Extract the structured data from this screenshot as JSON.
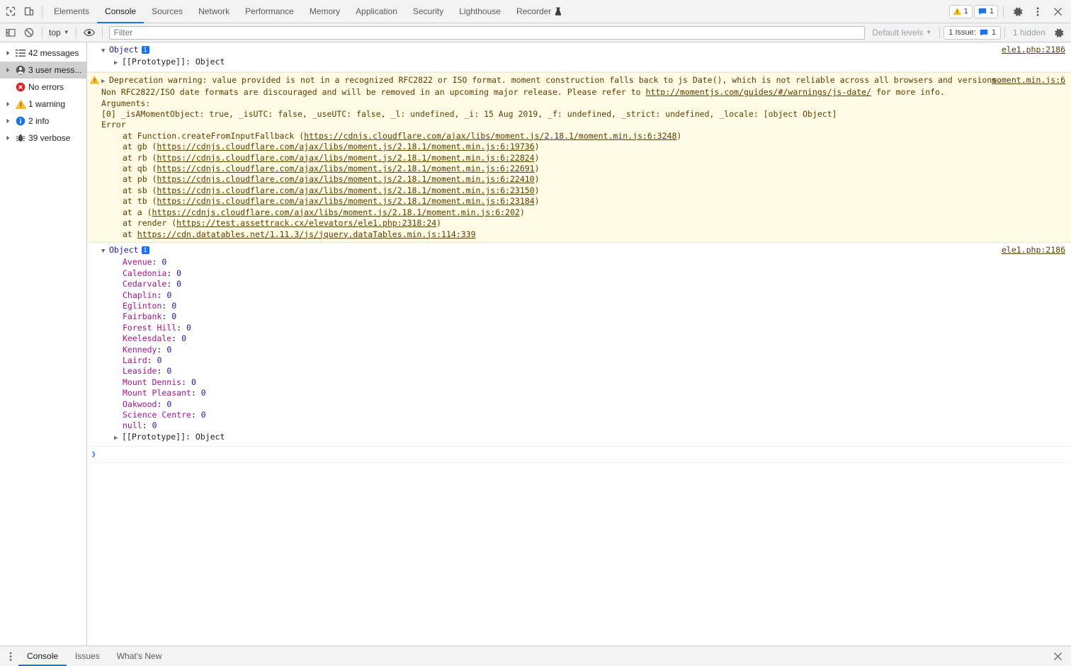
{
  "tabbar": {
    "left_icons": [
      {
        "name": "inspect-element-icon",
        "title": "Inspect"
      },
      {
        "name": "device-toolbar-icon",
        "title": "Toggle device toolbar"
      }
    ],
    "tabs": [
      {
        "label": "Elements",
        "active": false,
        "icon": null
      },
      {
        "label": "Console",
        "active": true,
        "icon": null
      },
      {
        "label": "Sources",
        "active": false,
        "icon": null
      },
      {
        "label": "Network",
        "active": false,
        "icon": null
      },
      {
        "label": "Performance",
        "active": false,
        "icon": null
      },
      {
        "label": "Memory",
        "active": false,
        "icon": null
      },
      {
        "label": "Application",
        "active": false,
        "icon": null
      },
      {
        "label": "Security",
        "active": false,
        "icon": null
      },
      {
        "label": "Lighthouse",
        "active": false,
        "icon": null
      },
      {
        "label": "Recorder",
        "active": false,
        "icon": "flask-icon"
      }
    ],
    "warning_badge_count": "1",
    "message_badge_count": "1"
  },
  "filterbar": {
    "sidebar_toggle": "console-sidebar-toggle-icon",
    "clear_label": "clear-console-icon",
    "context": "top",
    "eye_icon": "live-expression-icon",
    "filter_placeholder": "Filter",
    "filter_value": "",
    "levels_label": "Default levels",
    "issue_label": "1 Issue:",
    "issue_count": "1",
    "hidden_label": "1 hidden",
    "settings_icon": "gear-icon"
  },
  "sidebar": {
    "items": [
      {
        "label": "42 messages",
        "icon": "list-icon",
        "arrow": true,
        "selected": false
      },
      {
        "label": "3 user mess...",
        "icon": "user-icon",
        "arrow": true,
        "selected": true
      },
      {
        "label": "No errors",
        "icon": "error-icon",
        "arrow": false,
        "selected": false
      },
      {
        "label": "1 warning",
        "icon": "warning-icon",
        "arrow": true,
        "selected": false
      },
      {
        "label": "2 info",
        "icon": "info-icon",
        "arrow": true,
        "selected": false
      },
      {
        "label": "39 verbose",
        "icon": "verbose-bug-icon",
        "arrow": true,
        "selected": false
      }
    ]
  },
  "console": {
    "messages": [
      {
        "id": "msg-object-1",
        "type": "log",
        "object_label": "Object",
        "badge": "1",
        "proto_label": "[[Prototype]]: Object",
        "source_link": "ele1.php:2186"
      },
      {
        "id": "msg-deprecation-warning",
        "type": "warning",
        "source_link": "moment.min.js:6",
        "line1_a": "Deprecation warning: value provided is not in a recognized RFC2822 or ISO format. moment construction falls back to js Date(), which is not reliable across all browsers and versions.",
        "line2_a": "Non RFC2822/ISO date formats are discouraged and will be removed in an upcoming major release. Please refer to ",
        "line2_link": "http://momentjs.com/guides/#/warnings/js-date/",
        "line2_b": " for more info.",
        "line3": "Arguments:",
        "line4": "[0] _isAMomentObject: true, _isUTC: false, _useUTC: false, _l: undefined, _i: 15 Aug 2019, _f: undefined, _strict: undefined, _locale: [object Object]",
        "line5": "Error",
        "stack": [
          {
            "prefix": "at Function.createFromInputFallback (",
            "link": "https://cdnjs.cloudflare.com/ajax/libs/moment.js/2.18.1/moment.min.js:6:3248",
            "suffix": ")"
          },
          {
            "prefix": "at gb (",
            "link": "https://cdnjs.cloudflare.com/ajax/libs/moment.js/2.18.1/moment.min.js:6:19736",
            "suffix": ")"
          },
          {
            "prefix": "at rb (",
            "link": "https://cdnjs.cloudflare.com/ajax/libs/moment.js/2.18.1/moment.min.js:6:22824",
            "suffix": ")"
          },
          {
            "prefix": "at qb (",
            "link": "https://cdnjs.cloudflare.com/ajax/libs/moment.js/2.18.1/moment.min.js:6:22691",
            "suffix": ")"
          },
          {
            "prefix": "at pb (",
            "link": "https://cdnjs.cloudflare.com/ajax/libs/moment.js/2.18.1/moment.min.js:6:22410",
            "suffix": ")"
          },
          {
            "prefix": "at sb (",
            "link": "https://cdnjs.cloudflare.com/ajax/libs/moment.js/2.18.1/moment.min.js:6:23150",
            "suffix": ")"
          },
          {
            "prefix": "at tb (",
            "link": "https://cdnjs.cloudflare.com/ajax/libs/moment.js/2.18.1/moment.min.js:6:23184",
            "suffix": ")"
          },
          {
            "prefix": "at a (",
            "link": "https://cdnjs.cloudflare.com/ajax/libs/moment.js/2.18.1/moment.min.js:6:202",
            "suffix": ")"
          },
          {
            "prefix": "at render (",
            "link": "https://test.assettrack.cx/elevators/ele1.php:2318:24",
            "suffix": ")"
          },
          {
            "prefix": "at ",
            "link": "https://cdn.datatables.net/1.11.3/js/jquery.dataTables.min.js:114:339",
            "suffix": ""
          }
        ]
      },
      {
        "id": "msg-object-2",
        "type": "log",
        "object_label": "Object",
        "badge": "1",
        "source_link": "ele1.php:2186",
        "properties": [
          {
            "key": "Avenue",
            "value": "0"
          },
          {
            "key": "Caledonia",
            "value": "0"
          },
          {
            "key": "Cedarvale",
            "value": "0"
          },
          {
            "key": "Chaplin",
            "value": "0"
          },
          {
            "key": "Eglinton",
            "value": "0"
          },
          {
            "key": "Fairbank",
            "value": "0"
          },
          {
            "key": "Forest Hill",
            "value": "0"
          },
          {
            "key": "Keelesdale",
            "value": "0"
          },
          {
            "key": "Kennedy",
            "value": "0"
          },
          {
            "key": "Laird",
            "value": "0"
          },
          {
            "key": "Leaside",
            "value": "0"
          },
          {
            "key": "Mount Dennis",
            "value": "0"
          },
          {
            "key": "Mount Pleasant",
            "value": "0"
          },
          {
            "key": "Oakwood",
            "value": "0"
          },
          {
            "key": "Science Centre",
            "value": "0"
          },
          {
            "key": "null",
            "value": "0"
          }
        ],
        "proto_label": "[[Prototype]]: Object"
      }
    ],
    "prompt_symbol": "❯"
  },
  "drawer": {
    "tabs": [
      {
        "label": "Console",
        "active": true
      },
      {
        "label": "Issues",
        "active": false
      },
      {
        "label": "What's New",
        "active": false
      }
    ],
    "close_icon": "close-icon"
  },
  "colors": {
    "accent": "#1a73e8",
    "warning_bg": "#fffbe5",
    "warning_text": "#5a3d00",
    "prop_key": "#a3158d",
    "prop_value": "#1a1aa6",
    "toolbar_bg": "#f3f3f3"
  }
}
